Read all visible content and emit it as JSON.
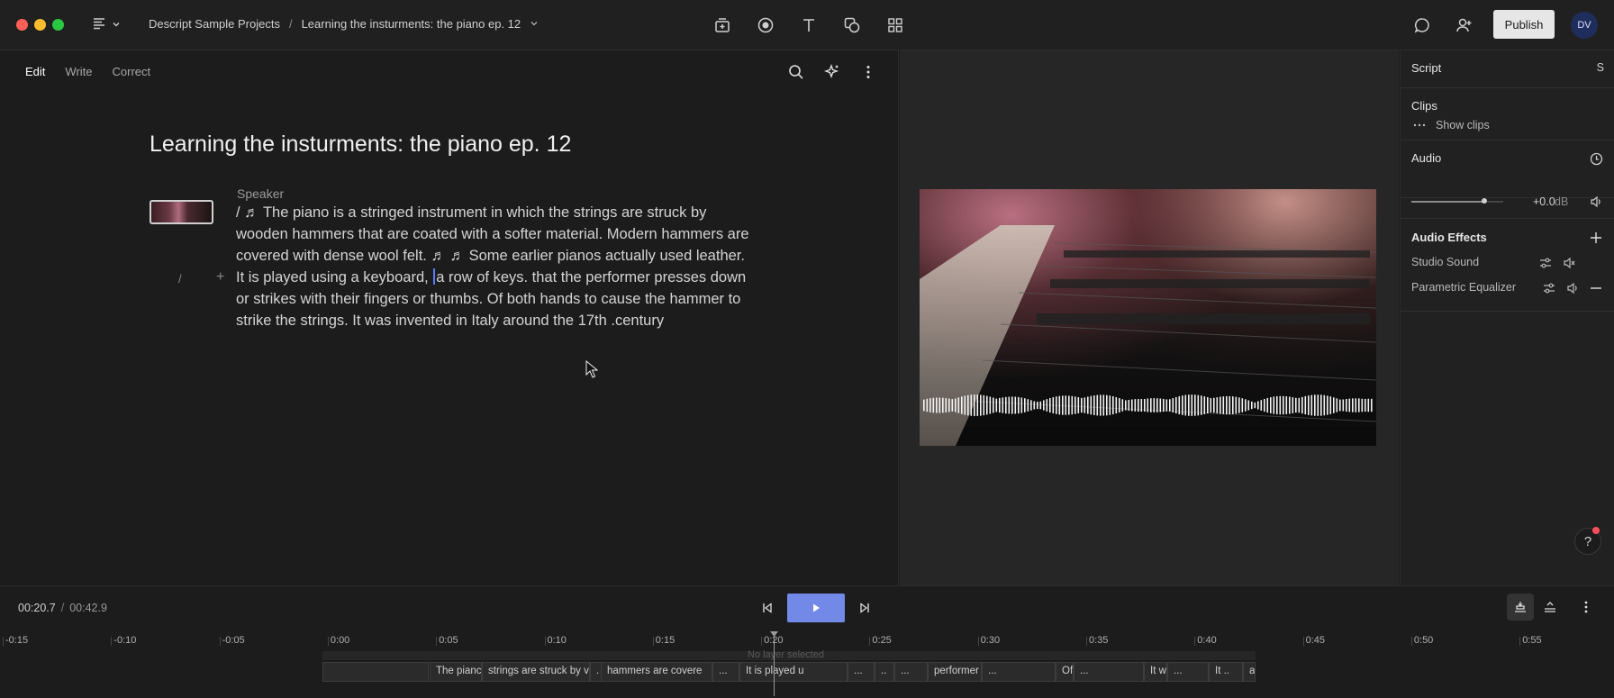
{
  "titlebar": {
    "breadcrumb_project": "Descript Sample Projects",
    "breadcrumb_sep": "/",
    "breadcrumb_doc": "Learning the insturments: the piano ep. 12",
    "publish_label": "Publish",
    "avatar_initials": "DV"
  },
  "editor": {
    "tabs": [
      "Edit",
      "Write",
      "Correct"
    ],
    "active_tab": "Edit",
    "title": "Learning the insturments: the piano ep. 12",
    "speaker": "Speaker",
    "gutter_slash": "/",
    "gutter_plus": "+",
    "transcript": {
      "part1": "/ ♬  The piano is a stringed instrument in which the strings are struck by wooden hammers that are coated with a softer material. Modern hammers are covered with dense wool felt.  ♬  ♬  Some earlier pianos actually used leather. It is played using a keyboard, ",
      "part2": "a row of keys. that the performer presses down or strikes with their fingers or thumbs. Of both hands to cause the hammer to strike the strings. It was invented in Italy around the 17th .century"
    }
  },
  "inspector": {
    "script_label": "Script",
    "script_shortcut": "S",
    "clips_label": "Clips",
    "show_clips": "Show clips",
    "audio_label": "Audio",
    "gain_value": "+0.0",
    "gain_unit": "dB",
    "audio_effects_label": "Audio Effects",
    "effects": [
      "Studio Sound",
      "Parametric Equalizer"
    ],
    "help": "?"
  },
  "timeline": {
    "current_time": "00:20.7",
    "separator": "/",
    "total_time": "00:42.9",
    "no_layer": "No layer selected",
    "ruler": [
      "-0:15",
      "-0:10",
      "-0:05",
      "0:00",
      "0:05",
      "0:10",
      "0:15",
      "0:20",
      "0:25",
      "0:30",
      "0:35",
      "0:40",
      "0:45",
      "0:50",
      "0:55"
    ],
    "clips": [
      "The pianc",
      "strings are struck by v",
      ".",
      "hammers are covere",
      "...",
      "It is played u",
      "...",
      "..",
      "...",
      "performer press",
      "...",
      "Of both han",
      "...",
      "It was in",
      "...",
      "It ..",
      "around"
    ]
  },
  "colors": {
    "accent_play": "#7289e8",
    "publish_bg": "#e6e6e6",
    "avatar_bg": "#1f2d5c",
    "cursor": "#5a7bff"
  }
}
